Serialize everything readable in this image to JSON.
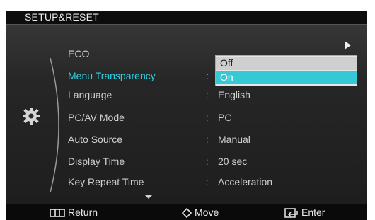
{
  "title": "SETUP&RESET",
  "menu": {
    "items": [
      {
        "label": "ECO",
        "value": "",
        "active": false
      },
      {
        "label": "Menu Transparency",
        "value": "",
        "active": true
      },
      {
        "label": "Language",
        "value": "English",
        "active": false
      },
      {
        "label": "PC/AV Mode",
        "value": "PC",
        "active": false
      },
      {
        "label": "Auto Source",
        "value": "Manual",
        "active": false
      },
      {
        "label": "Display Time",
        "value": "20 sec",
        "active": false
      },
      {
        "label": "Key Repeat Time",
        "value": "Acceleration",
        "active": false
      }
    ]
  },
  "dropdown": {
    "options": [
      "Off",
      "On"
    ],
    "selected": "On"
  },
  "footer": {
    "return_label": "Return",
    "move_label": "Move",
    "enter_label": "Enter"
  },
  "colors": {
    "accent": "#34c9d4",
    "active_text": "#2ed0e0",
    "background": "#1b1b1b"
  },
  "icons": {
    "category": "gear-icon",
    "return": "return-icon",
    "move": "move-icon",
    "enter": "enter-icon",
    "more": "right-arrow-icon",
    "scroll": "down-arrow-icon"
  }
}
